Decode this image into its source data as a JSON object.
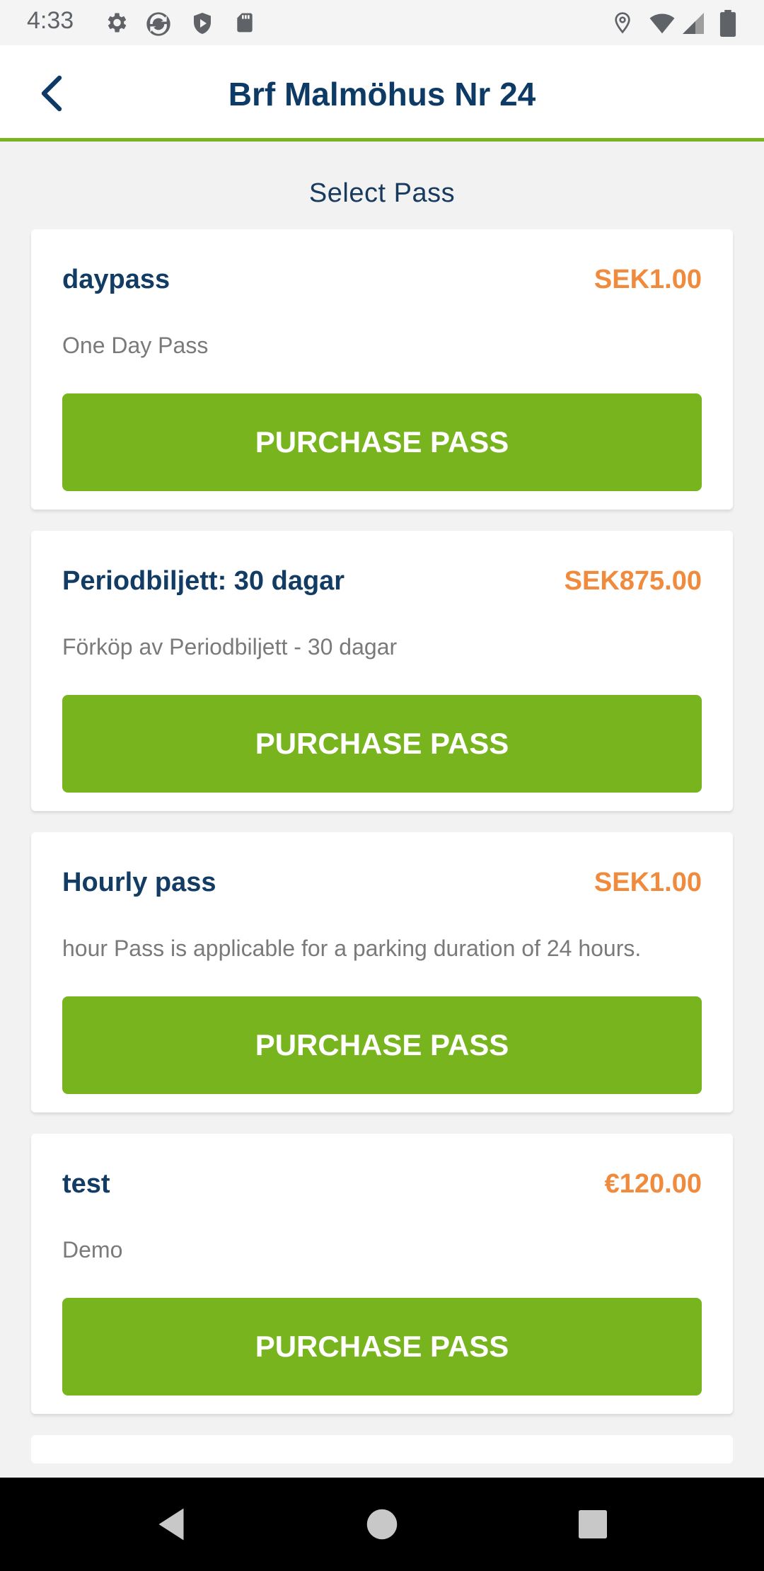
{
  "status_bar": {
    "time": "4:33",
    "left_icons": [
      "settings-icon",
      "sync-icon",
      "shield-icon",
      "sd-card-icon"
    ],
    "right_icons": [
      "location-icon",
      "wifi-icon",
      "signal-icon",
      "battery-icon"
    ]
  },
  "header": {
    "title": "Brf Malmöhus Nr 24",
    "back_icon": "chevron-left-icon",
    "accent_color": "#78b41e",
    "title_color": "#0d3b66"
  },
  "section_title": "Select Pass",
  "passes": [
    {
      "name": "daypass",
      "price": "SEK1.00",
      "description": "One Day Pass",
      "button": "PURCHASE PASS"
    },
    {
      "name": "Periodbiljett: 30 dagar",
      "price": "SEK875.00",
      "description": "Förköp av Periodbiljett - 30 dagar",
      "button": "PURCHASE PASS"
    },
    {
      "name": "Hourly pass",
      "price": "SEK1.00",
      "description": "hour Pass is applicable for a parking duration of 24 hours.",
      "button": "PURCHASE PASS"
    },
    {
      "name": "test",
      "price": "€120.00",
      "description": "Demo",
      "button": "PURCHASE PASS"
    }
  ],
  "colors": {
    "button": "#78b41e",
    "price": "#f08a3c",
    "background": "#f2f2f2"
  },
  "nav_bar": {
    "back": "nav-back-icon",
    "home": "nav-home-icon",
    "recents": "nav-recents-icon"
  }
}
